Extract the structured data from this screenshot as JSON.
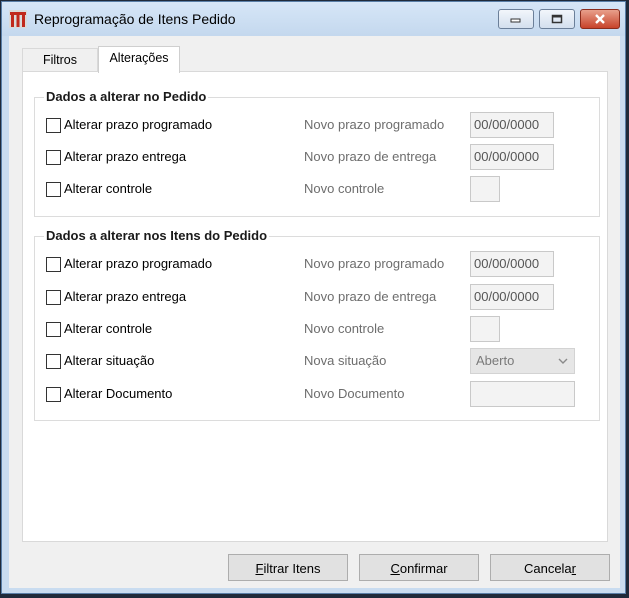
{
  "window": {
    "title": "Reprogramação de Itens Pedido",
    "icon": "app-logo-icon",
    "controls": [
      "minimize-icon",
      "maximize-icon",
      "close-icon"
    ]
  },
  "tabs": [
    {
      "label": "Filtros",
      "active": false
    },
    {
      "label": "Alterações",
      "active": true
    }
  ],
  "pedido": {
    "title": "Dados a alterar no Pedido",
    "rows": [
      {
        "checkbox": "Alterar prazo programado",
        "field_label": "Novo prazo programado",
        "value": "00/00/0000"
      },
      {
        "checkbox": "Alterar prazo entrega",
        "field_label": "Novo prazo de entrega",
        "value": "00/00/0000"
      },
      {
        "checkbox": "Alterar controle",
        "field_label": "Novo controle",
        "value": ""
      }
    ]
  },
  "itens": {
    "title": "Dados a alterar nos Itens do Pedido",
    "rows": [
      {
        "checkbox": "Alterar prazo programado",
        "field_label": "Novo prazo programado",
        "value": "00/00/0000"
      },
      {
        "checkbox": "Alterar prazo entrega",
        "field_label": "Novo prazo de entrega",
        "value": "00/00/0000"
      },
      {
        "checkbox": "Alterar controle",
        "field_label": "Novo controle",
        "value": ""
      },
      {
        "checkbox": "Alterar situação",
        "field_label": "Nova situação",
        "value": "Aberto"
      },
      {
        "checkbox": "Alterar Documento",
        "field_label": "Novo Documento",
        "value": ""
      }
    ]
  },
  "buttons": {
    "filtrar_lead": "F",
    "filtrar_rest": "iltrar Itens",
    "confirmar_lead": "C",
    "confirmar_rest": "onfirmar",
    "cancelar_head": "Cancela",
    "cancelar_tail": "r"
  },
  "colors": {
    "window_frame": "#c9dcf0",
    "close_button": "#c7432b",
    "panel_bg": "#ffffff"
  }
}
